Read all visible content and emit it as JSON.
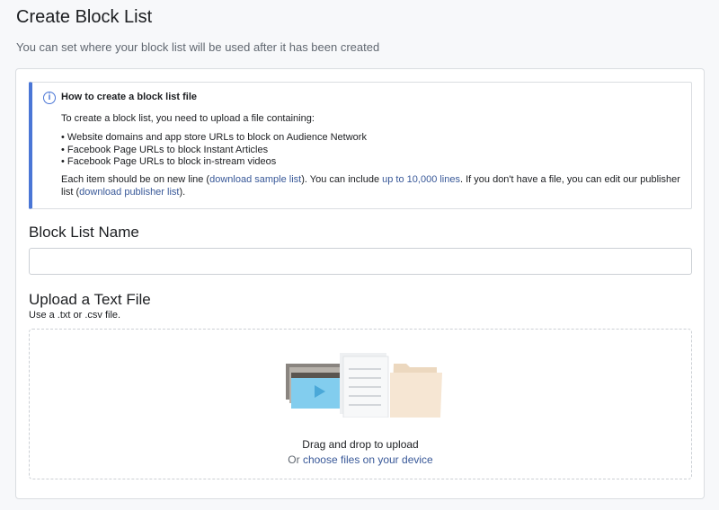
{
  "header": {
    "title": "Create Block List",
    "subtitle": "You can set where your block list will be used after it has been created"
  },
  "info": {
    "icon": "info-icon",
    "title": "How to create a block list file",
    "intro": "To create a block list, you need to upload a file containing:",
    "items": [
      "Website domains and app store URLs to block on Audience Network",
      "Facebook Page URLs to block Instant Articles",
      "Facebook Page URLs to block in-stream videos"
    ],
    "footer_part1": "Each item should be on new line (",
    "link_sample": "download sample list",
    "footer_part2": "). You can include ",
    "link_lines": "up to 10,000 lines",
    "footer_part3": ". If you don't have a file, you can edit our publisher list (",
    "link_publisher": "download publisher list",
    "footer_part4": ")."
  },
  "name_section": {
    "label": "Block List Name",
    "value": "",
    "placeholder": ""
  },
  "upload_section": {
    "label": "Upload a Text File",
    "hint": "Use a .txt or .csv file.",
    "illustration_icon": "file-upload-illustration-icon",
    "drag_text": "Drag and drop to upload",
    "or_text": "Or ",
    "choose_link": "choose files on your device"
  },
  "colors": {
    "accent": "#4a76d6",
    "link": "#385898",
    "border": "#dadde1"
  }
}
